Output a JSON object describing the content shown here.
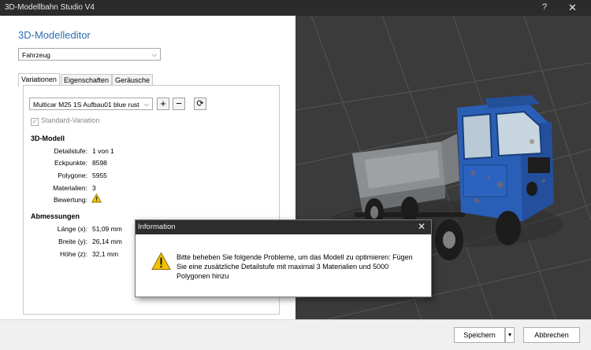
{
  "window": {
    "title": "3D-Modellbahn Studio V4",
    "help": "?",
    "close": "✕"
  },
  "editor": {
    "heading": "3D-Modelleditor",
    "category": "Fahrzeug",
    "tabs": [
      "Variationen",
      "Eigenschaften",
      "Geräusche"
    ],
    "variation": "Multicar M25 1S Aufbau01 blue rust",
    "add": "+",
    "remove": "−",
    "refresh": "⟳",
    "standard_variation": "Standard-Variation",
    "model": {
      "title": "3D-Modell",
      "rows": [
        {
          "label": "Detailstufe:",
          "value": "1 von 1"
        },
        {
          "label": "Eckpunkte:",
          "value": "8598"
        },
        {
          "label": "Polygone:",
          "value": "5955"
        },
        {
          "label": "Materialien:",
          "value": "3"
        },
        {
          "label": "Bewertung:",
          "value": ""
        }
      ]
    },
    "dims": {
      "title": "Abmessungen",
      "rows": [
        {
          "label": "Länge (x):",
          "value": "51,09 mm"
        },
        {
          "label": "Breite (y):",
          "value": "26,14 mm"
        },
        {
          "label": "Höhe (z):",
          "value": "32,1 mm"
        }
      ]
    }
  },
  "dialog": {
    "title": "Information",
    "close": "✕",
    "message": "Bitte beheben Sie folgende Probleme, um das Modell zu optimieren: Fügen Sie eine zusätzliche Detailstufe mit maximal 3 Materialien und 5000 Polygonen hinzu",
    "icon": "warning-icon"
  },
  "footer": {
    "save": "Speichern",
    "save_menu": "▾",
    "cancel": "Abbrechen"
  },
  "colors": {
    "accent": "#2b6cb0",
    "truck": "#2a5fb8",
    "warning": "#f2c200"
  }
}
